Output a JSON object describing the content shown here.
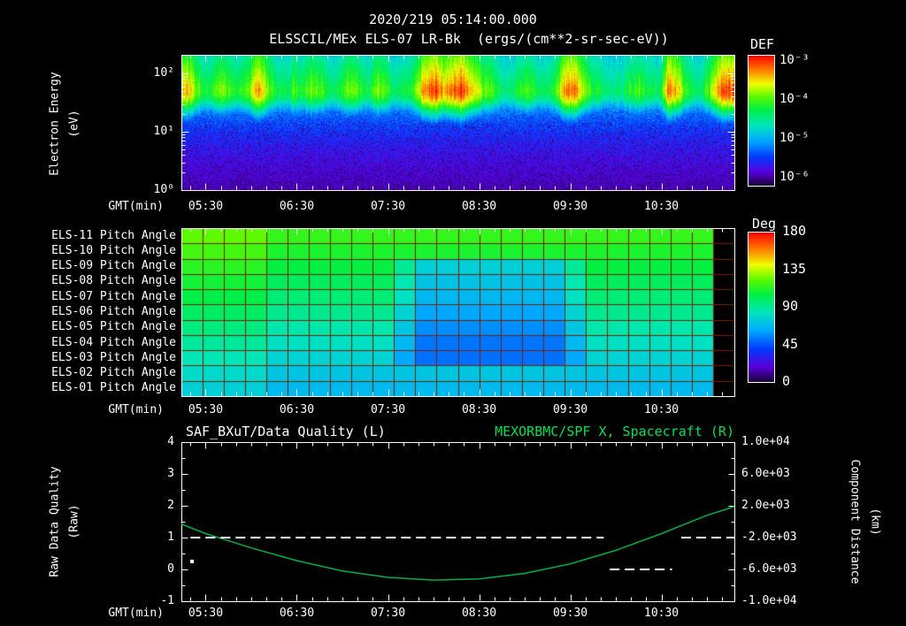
{
  "header": {
    "timestamp": "2020/219 05:14:00.000",
    "subtitle": "ELSSCIL/MEx ELS-07 LR-Bk  (ergs/(cm**2-sr-sec-eV))"
  },
  "colors": {
    "background": "#000000",
    "axis": "#ffffff",
    "text": "#ffffff",
    "title_right_green": "#00e050",
    "curve_green": "#00b044",
    "quality_white": "#ffffff",
    "grid_red": "#782000",
    "rainbow_stops": [
      [
        0,
        25,
        0,
        60
      ],
      [
        0.1,
        90,
        0,
        220
      ],
      [
        0.22,
        0,
        60,
        255
      ],
      [
        0.34,
        0,
        170,
        255
      ],
      [
        0.46,
        0,
        230,
        190
      ],
      [
        0.58,
        0,
        240,
        70
      ],
      [
        0.68,
        90,
        250,
        0
      ],
      [
        0.78,
        240,
        255,
        0
      ],
      [
        0.88,
        255,
        130,
        0
      ],
      [
        1,
        255,
        0,
        0
      ]
    ]
  },
  "panels": {
    "spectrogram": {
      "ylabel_line1": "Electron Energy",
      "ylabel_line2": "(eV)",
      "xlabel": "GMT(min)",
      "x_tick_labels": [
        "05:30",
        "06:30",
        "07:30",
        "08:30",
        "09:30",
        "10:30"
      ],
      "y_tick_labels": [
        "10²",
        "10¹",
        "10⁰"
      ],
      "colorbar_title": "DEF",
      "colorbar_tick_labels": [
        "10⁻³",
        "10⁻⁴",
        "10⁻⁵",
        "10⁻⁶"
      ]
    },
    "pitch": {
      "row_labels": [
        "ELS-11 Pitch Angle",
        "ELS-10 Pitch Angle",
        "ELS-09 Pitch Angle",
        "ELS-08 Pitch Angle",
        "ELS-07 Pitch Angle",
        "ELS-06 Pitch Angle",
        "ELS-05 Pitch Angle",
        "ELS-04 Pitch Angle",
        "ELS-03 Pitch Angle",
        "ELS-02 Pitch Angle",
        "ELS-01 Pitch Angle"
      ],
      "xlabel": "GMT(min)",
      "x_tick_labels": [
        "05:30",
        "06:30",
        "07:30",
        "08:30",
        "09:30",
        "10:30"
      ],
      "colorbar_title": "Deg",
      "colorbar_tick_labels": [
        "180",
        "135",
        "90",
        "45",
        "0"
      ]
    },
    "timeseries": {
      "title_left": "SAF_BXuT/Data Quality (L)",
      "title_right": "MEXORBMC/SPF X, Spacecraft (R)",
      "xlabel": "GMT(min)",
      "x_tick_labels": [
        "05:30",
        "06:30",
        "07:30",
        "08:30",
        "09:30",
        "10:30"
      ],
      "left_ylabel_line1": "Raw Data Quality",
      "left_ylabel_line2": "(Raw)",
      "left_tick_labels": [
        "4",
        "3",
        "2",
        "1",
        "0",
        "-1"
      ],
      "right_ylabel_line1": "Component Distance",
      "right_ylabel_line2": "(km)",
      "right_tick_labels": [
        "1.0e+04",
        "6.0e+03",
        "2.0e+03",
        "-2.0e+03",
        "-6.0e+03",
        "-1.0e+04"
      ]
    }
  },
  "chart_data": [
    {
      "id": "electron_energy_spectrogram",
      "type": "heatmap",
      "title": "ELSSCIL/MEx ELS-07 LR-Bk",
      "units": "ergs/(cm**2-sr-sec-eV)",
      "xlabel": "GMT(min)",
      "ylabel": "Electron Energy (eV)",
      "x_start_gmt": "05:14:00.000",
      "x_tick_labels": [
        "05:30",
        "06:30",
        "07:30",
        "08:30",
        "09:30",
        "10:30"
      ],
      "y_scale": "log",
      "y_range_ev": [
        1,
        200
      ],
      "colorbar": {
        "title": "DEF",
        "tick_labels": [
          "10⁻³",
          "10⁻⁴",
          "10⁻⁵",
          "10⁻⁶"
        ],
        "flux_range": [
          1e-06,
          0.001
        ]
      },
      "band_center": 0.26,
      "noise_seed": 77,
      "column_intensity": [
        0.85,
        0.8,
        0.65,
        0.6,
        0.72,
        0.66,
        0.6,
        0.68,
        0.88,
        0.75,
        0.62,
        0.55,
        0.66,
        0.6,
        0.7,
        0.62,
        0.55,
        0.6,
        0.72,
        0.65,
        0.58,
        0.7,
        0.62,
        0.55,
        0.6,
        0.66,
        0.88,
        0.95,
        0.85,
        0.9,
        0.95,
        0.8,
        0.7,
        0.64,
        0.58,
        0.55,
        0.6,
        0.66,
        0.6,
        0.55,
        0.62,
        0.9,
        0.93,
        0.7,
        0.6,
        0.55,
        0.5,
        0.55,
        0.62,
        0.66,
        0.6,
        0.55,
        0.88,
        0.82,
        0.6,
        0.55,
        0.62,
        0.8,
        0.95,
        0.9
      ]
    },
    {
      "id": "pitch_angle_heatmap",
      "type": "heatmap",
      "rows": [
        "ELS-11",
        "ELS-10",
        "ELS-09",
        "ELS-08",
        "ELS-07",
        "ELS-06",
        "ELS-05",
        "ELS-04",
        "ELS-03",
        "ELS-02",
        "ELS-01"
      ],
      "units": "Deg",
      "colorbar": {
        "title": "Deg",
        "tick_labels": [
          "180",
          "135",
          "90",
          "45",
          "0"
        ],
        "range": [
          0,
          180
        ]
      },
      "x_tick_labels": [
        "05:30",
        "06:30",
        "07:30",
        "08:30",
        "09:30",
        "10:30"
      ],
      "values_deg": [
        [
          123,
          123,
          123,
          123,
          115,
          115,
          115,
          115,
          115,
          115,
          115,
          115,
          115,
          115,
          115,
          115,
          115,
          115,
          115,
          115,
          115,
          115,
          115,
          115,
          115,
          null
        ],
        [
          118,
          118,
          118,
          118,
          110,
          110,
          110,
          110,
          110,
          110,
          110,
          110,
          110,
          110,
          110,
          110,
          110,
          110,
          110,
          110,
          110,
          110,
          110,
          110,
          110,
          null
        ],
        [
          113,
          113,
          113,
          113,
          105,
          105,
          105,
          105,
          105,
          105,
          90,
          75,
          75,
          75,
          75,
          75,
          75,
          75,
          90,
          105,
          105,
          105,
          105,
          105,
          105,
          null
        ],
        [
          108,
          108,
          108,
          108,
          100,
          100,
          100,
          100,
          100,
          100,
          85,
          70,
          70,
          70,
          70,
          70,
          70,
          70,
          85,
          100,
          100,
          100,
          100,
          100,
          100,
          null
        ],
        [
          104,
          104,
          104,
          104,
          96,
          96,
          96,
          96,
          96,
          96,
          81,
          66,
          66,
          66,
          66,
          66,
          66,
          66,
          81,
          96,
          96,
          96,
          96,
          96,
          96,
          null
        ],
        [
          99,
          99,
          99,
          99,
          91,
          91,
          91,
          91,
          91,
          91,
          76,
          61,
          61,
          61,
          61,
          61,
          61,
          61,
          76,
          91,
          91,
          91,
          91,
          91,
          91,
          null
        ],
        [
          94,
          94,
          94,
          94,
          86,
          86,
          86,
          86,
          86,
          86,
          71,
          56,
          56,
          56,
          56,
          56,
          56,
          56,
          71,
          86,
          86,
          86,
          86,
          86,
          86,
          null
        ],
        [
          89,
          89,
          89,
          89,
          81,
          81,
          81,
          81,
          81,
          81,
          66,
          51,
          51,
          51,
          51,
          51,
          51,
          51,
          66,
          81,
          81,
          81,
          81,
          81,
          81,
          null
        ],
        [
          84,
          84,
          84,
          84,
          76,
          76,
          76,
          76,
          76,
          76,
          61,
          50,
          50,
          50,
          50,
          50,
          50,
          50,
          61,
          76,
          76,
          76,
          76,
          76,
          76,
          null
        ],
        [
          79,
          79,
          79,
          79,
          71,
          71,
          71,
          71,
          71,
          71,
          71,
          71,
          71,
          71,
          71,
          71,
          71,
          71,
          71,
          71,
          71,
          71,
          71,
          71,
          71,
          null
        ],
        [
          75,
          75,
          75,
          75,
          67,
          67,
          67,
          67,
          67,
          67,
          67,
          67,
          67,
          67,
          67,
          67,
          67,
          67,
          67,
          67,
          67,
          67,
          67,
          67,
          67,
          null
        ]
      ]
    },
    {
      "id": "quality_and_spacecraft_x",
      "type": "line",
      "x_total_minutes": 364,
      "x_tick_minutes": [
        16,
        76,
        136,
        196,
        256,
        316
      ],
      "x_tick_labels": [
        "05:30",
        "06:30",
        "07:30",
        "08:30",
        "09:30",
        "10:30"
      ],
      "left_axis": {
        "label": "Raw Data Quality (Raw)",
        "ylim": [
          -1,
          4
        ]
      },
      "right_axis": {
        "label": "Component Distance (km)",
        "ylim": [
          -10000,
          10000
        ]
      },
      "series": [
        {
          "name": "SAF_BXuT/Data Quality (L)",
          "axis": "left",
          "style": "dashed-white",
          "segments": [
            {
              "t0": 6,
              "t1": 278,
              "value": 1
            },
            {
              "t0": 282,
              "t1": 323,
              "value": 0
            },
            {
              "t0": 329,
              "t1": 364,
              "value": 1
            }
          ],
          "dots": [
            {
              "t": 7,
              "value": 0.25
            }
          ]
        },
        {
          "name": "MEXORBMC/SPF X, Spacecraft (R)",
          "axis": "right",
          "style": "solid-green",
          "t_minutes": [
            0,
            16,
            46,
            76,
            106,
            136,
            166,
            196,
            226,
            256,
            286,
            316,
            346,
            364
          ],
          "km": [
            -300,
            -1500,
            -3300,
            -4900,
            -6200,
            -7000,
            -7350,
            -7200,
            -6500,
            -5300,
            -3600,
            -1500,
            800,
            1900
          ]
        }
      ]
    }
  ]
}
